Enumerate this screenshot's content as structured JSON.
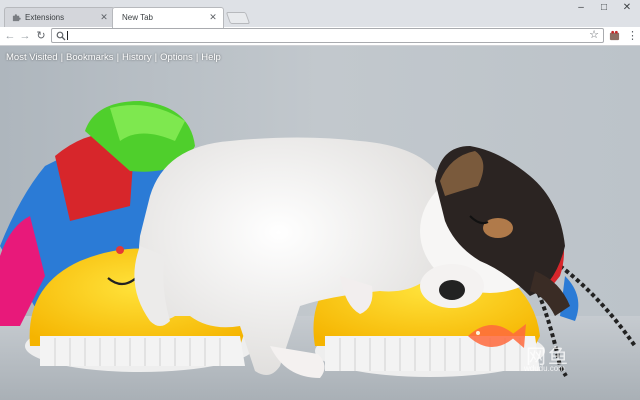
{
  "tabs": [
    {
      "label": "Extensions",
      "active": false
    },
    {
      "label": "New Tab",
      "active": true
    }
  ],
  "window_controls": {
    "minimize": "–",
    "maximize": "□",
    "close": "✕"
  },
  "toolbar": {
    "back": "←",
    "forward": "→",
    "reload": "↻",
    "omnibox_value": "",
    "bookmark_star": "☆",
    "menu": "⋮"
  },
  "nav_links": [
    "Most Visited",
    "Bookmarks",
    "History",
    "Options",
    "Help"
  ],
  "nav_separator": "|",
  "watermark": {
    "text": "网鱼",
    "url": "wdudu.com"
  },
  "colors": {
    "tabstrip": "#dee1e6",
    "active_tab": "#ffffff",
    "link_text": "#ffffff",
    "watermark_fish": "#ff6a3d"
  }
}
